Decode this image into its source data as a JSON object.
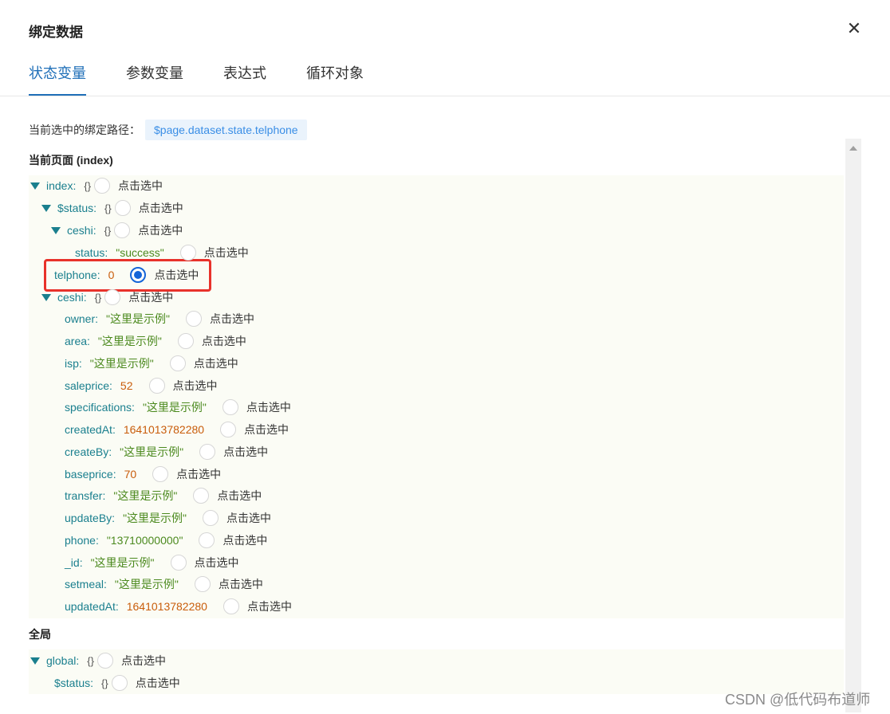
{
  "dialog": {
    "title": "绑定数据",
    "close_icon": "close-icon",
    "tabs": [
      {
        "label": "状态变量",
        "active": true
      },
      {
        "label": "参数变量",
        "active": false
      },
      {
        "label": "表达式",
        "active": false
      },
      {
        "label": "循环对象",
        "active": false
      }
    ]
  },
  "path": {
    "label": "当前选中的绑定路径：",
    "value": "$page.dataset.state.telphone"
  },
  "pick_label": "点击选中",
  "obj_marker": "{}",
  "current_page": {
    "title": "当前页面 (index)",
    "rows": [
      {
        "key": "index",
        "type": "object",
        "expanded": true,
        "checked": false
      },
      {
        "key": "$status",
        "type": "object",
        "expanded": true,
        "checked": false
      },
      {
        "key": "ceshi",
        "type": "object",
        "expanded": true,
        "checked": false
      },
      {
        "key": "status",
        "type": "string",
        "value": "\"success\"",
        "checked": false
      },
      {
        "key": "telphone",
        "type": "number",
        "value": "0",
        "checked": true
      },
      {
        "key": "ceshi",
        "type": "object",
        "expanded": true,
        "checked": false
      },
      {
        "key": "owner",
        "type": "string",
        "value": "\"这里是示例\"",
        "checked": false
      },
      {
        "key": "area",
        "type": "string",
        "value": "\"这里是示例\"",
        "checked": false
      },
      {
        "key": "isp",
        "type": "string",
        "value": "\"这里是示例\"",
        "checked": false
      },
      {
        "key": "saleprice",
        "type": "number",
        "value": "52",
        "checked": false
      },
      {
        "key": "specifications",
        "type": "string",
        "value": "\"这里是示例\"",
        "checked": false
      },
      {
        "key": "createdAt",
        "type": "number",
        "value": "1641013782280",
        "checked": false
      },
      {
        "key": "createBy",
        "type": "string",
        "value": "\"这里是示例\"",
        "checked": false
      },
      {
        "key": "baseprice",
        "type": "number",
        "value": "70",
        "checked": false
      },
      {
        "key": "transfer",
        "type": "string",
        "value": "\"这里是示例\"",
        "checked": false
      },
      {
        "key": "updateBy",
        "type": "string",
        "value": "\"这里是示例\"",
        "checked": false
      },
      {
        "key": "phone",
        "type": "string",
        "value": "\"13710000000\"",
        "checked": false
      },
      {
        "key": "_id",
        "type": "string",
        "value": "\"这里是示例\"",
        "checked": false
      },
      {
        "key": "setmeal",
        "type": "string",
        "value": "\"这里是示例\"",
        "checked": false
      },
      {
        "key": "updatedAt",
        "type": "number",
        "value": "1641013782280",
        "checked": false
      }
    ]
  },
  "global": {
    "title": "全局",
    "rows": [
      {
        "key": "global",
        "type": "object",
        "expanded": true,
        "checked": false
      },
      {
        "key": "$status",
        "type": "object",
        "expanded": false,
        "checked": false
      }
    ]
  },
  "watermark": "CSDN @低代码布道师",
  "colors": {
    "accent": "#1f6fb8",
    "key": "#1a7f8e",
    "string": "#4c8a1f",
    "number": "#c95d0b",
    "highlight_box": "#e8322b",
    "radio_checked": "#1565d8"
  }
}
